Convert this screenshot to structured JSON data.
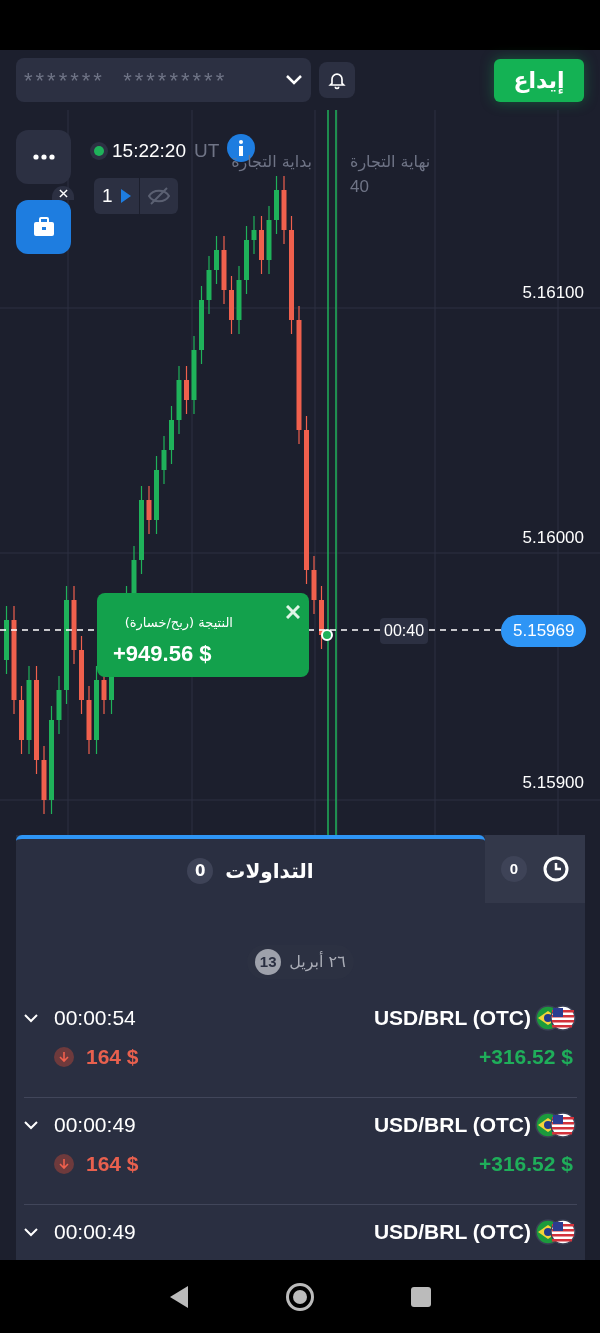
{
  "header": {
    "account_mask": "*******  *********",
    "deposit_button": "إيداع"
  },
  "chart": {
    "time": "15:22:20",
    "timezone": "UT",
    "expiry_count": "1",
    "trade_start_label": "بداية التجارة",
    "trade_end_label": "نهاية التجارة",
    "trade_end_value": "40",
    "price_labels": [
      "5.16100",
      "5.16000",
      "5.15900"
    ],
    "current_price": "5.15969",
    "countdown": "00:40",
    "result": {
      "label": "النتيجة (ربح/خسارة)",
      "amount": "+949.56 $"
    }
  },
  "panel": {
    "tabs": [
      {
        "kind": "trades",
        "label": "التداولات",
        "count": "0",
        "selected": true
      },
      {
        "kind": "clock",
        "count": "0",
        "selected": false
      }
    ],
    "date_badge": "13",
    "date": "٢٦ أبريل",
    "trades": [
      {
        "duration": "00:00:54",
        "asset": "USD/BRL (OTC)",
        "stake": "164 $",
        "profit": "+316.52 $",
        "kind": "down"
      },
      {
        "duration": "00:00:49",
        "asset": "USD/BRL (OTC)",
        "stake": "164 $",
        "profit": "+316.52 $",
        "kind": "down"
      },
      {
        "duration": "00:00:49",
        "asset": "USD/BRL (OTC)"
      }
    ]
  }
}
